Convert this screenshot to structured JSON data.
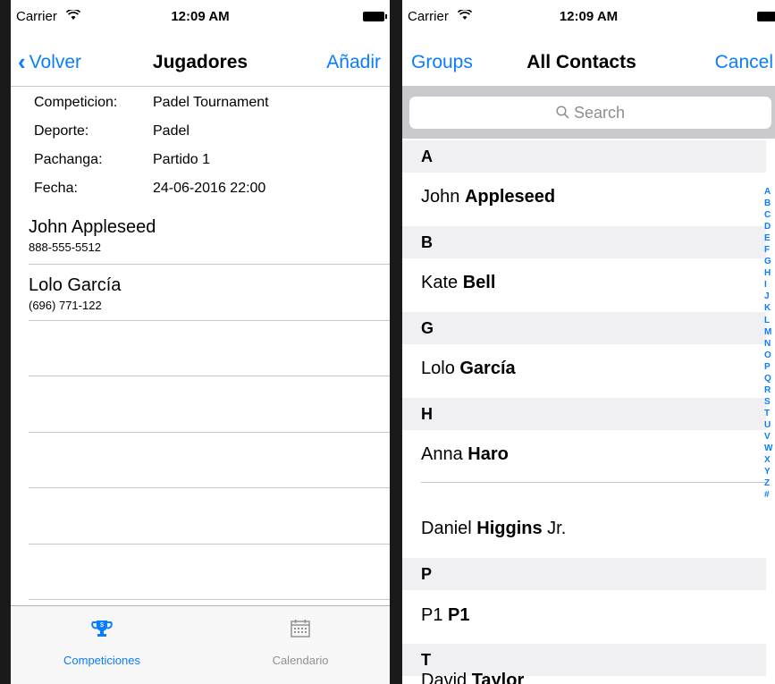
{
  "left": {
    "status": {
      "carrier": "Carrier",
      "wifi": "ẉ",
      "time": "12:09 AM"
    },
    "nav": {
      "back": "Volver",
      "title": "Jugadores",
      "right": "Añadir"
    },
    "info": [
      {
        "k": "Competicion:",
        "v": "Padel Tournament"
      },
      {
        "k": "Deporte:",
        "v": "Padel"
      },
      {
        "k": "Pachanga:",
        "v": "Partido 1"
      },
      {
        "k": "Fecha:",
        "v": "24-06-2016 22:00"
      }
    ],
    "players": [
      {
        "name": "John Appleseed",
        "phone": "888-555-5512"
      },
      {
        "name": "Lolo García",
        "phone": "(696) 771-122"
      }
    ],
    "tabs": [
      {
        "label": "Competiciones",
        "icon": "trophy-icon",
        "color": "#0a7cff"
      },
      {
        "label": "Calendario",
        "icon": "calendar-icon",
        "color": "#929292"
      }
    ]
  },
  "right": {
    "status": {
      "carrier": "Carrier",
      "time": "12:09 AM"
    },
    "nav": {
      "left": "Groups",
      "title": "All Contacts",
      "right": "Cancel"
    },
    "search": {
      "placeholder": "Search"
    },
    "sections": [
      {
        "letter": "A",
        "contacts": [
          {
            "first": "John",
            "last": "Appleseed",
            "suffix": ""
          }
        ]
      },
      {
        "letter": "B",
        "contacts": [
          {
            "first": "Kate",
            "last": "Bell",
            "suffix": ""
          }
        ]
      },
      {
        "letter": "G",
        "contacts": [
          {
            "first": "Lolo",
            "last": "García",
            "suffix": ""
          }
        ]
      },
      {
        "letter": "H",
        "contacts": [
          {
            "first": "Anna",
            "last": "Haro",
            "suffix": ""
          },
          {
            "first": "Daniel",
            "last": "Higgins",
            "suffix": "Jr."
          }
        ]
      },
      {
        "letter": "P",
        "contacts": [
          {
            "first": "P1",
            "last": "P1",
            "suffix": ""
          }
        ]
      },
      {
        "letter": "T",
        "contacts": [
          {
            "first": "David",
            "last": "Taylor",
            "suffix": ""
          }
        ]
      }
    ],
    "index": [
      "A",
      "B",
      "C",
      "D",
      "E",
      "F",
      "G",
      "H",
      "I",
      "J",
      "K",
      "L",
      "M",
      "N",
      "O",
      "P",
      "Q",
      "R",
      "S",
      "T",
      "U",
      "V",
      "W",
      "X",
      "Y",
      "Z",
      "#"
    ],
    "accent": "#0a7cff"
  }
}
